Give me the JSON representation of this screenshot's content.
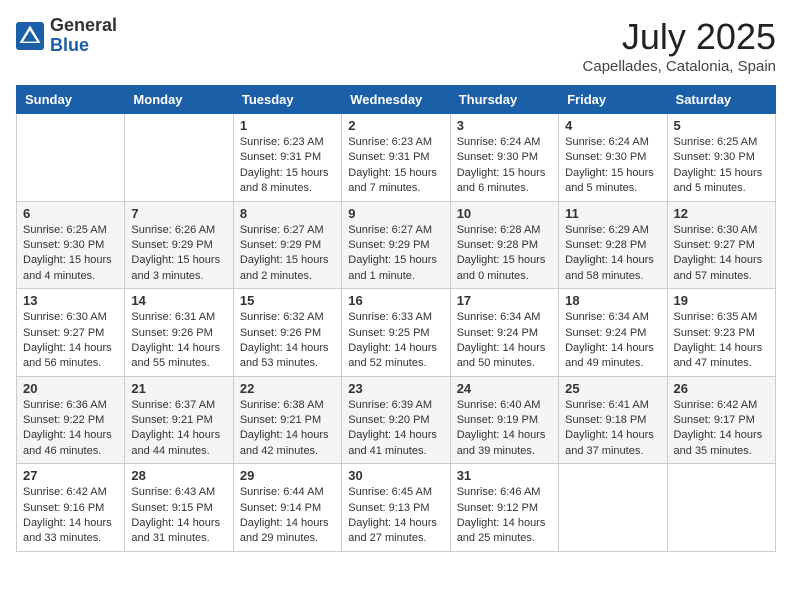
{
  "header": {
    "logo_general": "General",
    "logo_blue": "Blue",
    "month_year": "July 2025",
    "location": "Capellades, Catalonia, Spain"
  },
  "days_of_week": [
    "Sunday",
    "Monday",
    "Tuesday",
    "Wednesday",
    "Thursday",
    "Friday",
    "Saturday"
  ],
  "weeks": [
    [
      {
        "day": "",
        "info": ""
      },
      {
        "day": "",
        "info": ""
      },
      {
        "day": "1",
        "info": "Sunrise: 6:23 AM\nSunset: 9:31 PM\nDaylight: 15 hours and 8 minutes."
      },
      {
        "day": "2",
        "info": "Sunrise: 6:23 AM\nSunset: 9:31 PM\nDaylight: 15 hours and 7 minutes."
      },
      {
        "day": "3",
        "info": "Sunrise: 6:24 AM\nSunset: 9:30 PM\nDaylight: 15 hours and 6 minutes."
      },
      {
        "day": "4",
        "info": "Sunrise: 6:24 AM\nSunset: 9:30 PM\nDaylight: 15 hours and 5 minutes."
      },
      {
        "day": "5",
        "info": "Sunrise: 6:25 AM\nSunset: 9:30 PM\nDaylight: 15 hours and 5 minutes."
      }
    ],
    [
      {
        "day": "6",
        "info": "Sunrise: 6:25 AM\nSunset: 9:30 PM\nDaylight: 15 hours and 4 minutes."
      },
      {
        "day": "7",
        "info": "Sunrise: 6:26 AM\nSunset: 9:29 PM\nDaylight: 15 hours and 3 minutes."
      },
      {
        "day": "8",
        "info": "Sunrise: 6:27 AM\nSunset: 9:29 PM\nDaylight: 15 hours and 2 minutes."
      },
      {
        "day": "9",
        "info": "Sunrise: 6:27 AM\nSunset: 9:29 PM\nDaylight: 15 hours and 1 minute."
      },
      {
        "day": "10",
        "info": "Sunrise: 6:28 AM\nSunset: 9:28 PM\nDaylight: 15 hours and 0 minutes."
      },
      {
        "day": "11",
        "info": "Sunrise: 6:29 AM\nSunset: 9:28 PM\nDaylight: 14 hours and 58 minutes."
      },
      {
        "day": "12",
        "info": "Sunrise: 6:30 AM\nSunset: 9:27 PM\nDaylight: 14 hours and 57 minutes."
      }
    ],
    [
      {
        "day": "13",
        "info": "Sunrise: 6:30 AM\nSunset: 9:27 PM\nDaylight: 14 hours and 56 minutes."
      },
      {
        "day": "14",
        "info": "Sunrise: 6:31 AM\nSunset: 9:26 PM\nDaylight: 14 hours and 55 minutes."
      },
      {
        "day": "15",
        "info": "Sunrise: 6:32 AM\nSunset: 9:26 PM\nDaylight: 14 hours and 53 minutes."
      },
      {
        "day": "16",
        "info": "Sunrise: 6:33 AM\nSunset: 9:25 PM\nDaylight: 14 hours and 52 minutes."
      },
      {
        "day": "17",
        "info": "Sunrise: 6:34 AM\nSunset: 9:24 PM\nDaylight: 14 hours and 50 minutes."
      },
      {
        "day": "18",
        "info": "Sunrise: 6:34 AM\nSunset: 9:24 PM\nDaylight: 14 hours and 49 minutes."
      },
      {
        "day": "19",
        "info": "Sunrise: 6:35 AM\nSunset: 9:23 PM\nDaylight: 14 hours and 47 minutes."
      }
    ],
    [
      {
        "day": "20",
        "info": "Sunrise: 6:36 AM\nSunset: 9:22 PM\nDaylight: 14 hours and 46 minutes."
      },
      {
        "day": "21",
        "info": "Sunrise: 6:37 AM\nSunset: 9:21 PM\nDaylight: 14 hours and 44 minutes."
      },
      {
        "day": "22",
        "info": "Sunrise: 6:38 AM\nSunset: 9:21 PM\nDaylight: 14 hours and 42 minutes."
      },
      {
        "day": "23",
        "info": "Sunrise: 6:39 AM\nSunset: 9:20 PM\nDaylight: 14 hours and 41 minutes."
      },
      {
        "day": "24",
        "info": "Sunrise: 6:40 AM\nSunset: 9:19 PM\nDaylight: 14 hours and 39 minutes."
      },
      {
        "day": "25",
        "info": "Sunrise: 6:41 AM\nSunset: 9:18 PM\nDaylight: 14 hours and 37 minutes."
      },
      {
        "day": "26",
        "info": "Sunrise: 6:42 AM\nSunset: 9:17 PM\nDaylight: 14 hours and 35 minutes."
      }
    ],
    [
      {
        "day": "27",
        "info": "Sunrise: 6:42 AM\nSunset: 9:16 PM\nDaylight: 14 hours and 33 minutes."
      },
      {
        "day": "28",
        "info": "Sunrise: 6:43 AM\nSunset: 9:15 PM\nDaylight: 14 hours and 31 minutes."
      },
      {
        "day": "29",
        "info": "Sunrise: 6:44 AM\nSunset: 9:14 PM\nDaylight: 14 hours and 29 minutes."
      },
      {
        "day": "30",
        "info": "Sunrise: 6:45 AM\nSunset: 9:13 PM\nDaylight: 14 hours and 27 minutes."
      },
      {
        "day": "31",
        "info": "Sunrise: 6:46 AM\nSunset: 9:12 PM\nDaylight: 14 hours and 25 minutes."
      },
      {
        "day": "",
        "info": ""
      },
      {
        "day": "",
        "info": ""
      }
    ]
  ]
}
